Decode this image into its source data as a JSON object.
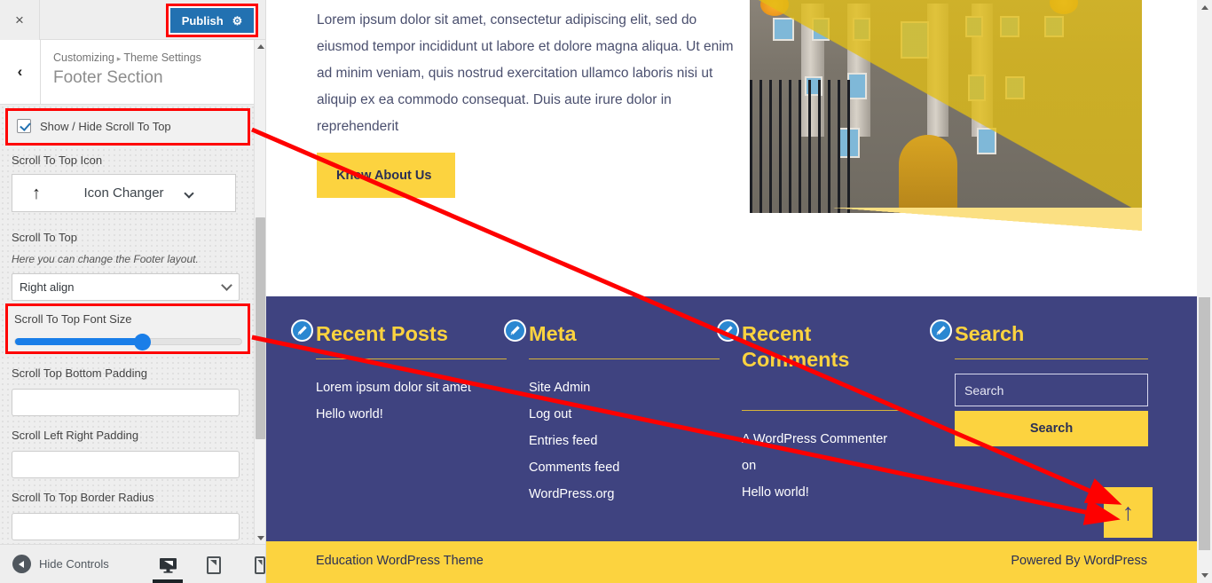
{
  "customizer": {
    "close_label": "×",
    "publish_label": "Publish",
    "gear_icon": "gear-icon",
    "back_label": "‹",
    "breadcrumb_root": "Customizing",
    "breadcrumb_sep": "▸",
    "breadcrumb_parent": "Theme Settings",
    "panel_title": "Footer Section",
    "hide_controls_label": "Hide Controls",
    "devices": [
      "desktop",
      "tablet",
      "mobile"
    ],
    "active_device": "desktop",
    "controls": {
      "show_hide_label": "Show / Hide Scroll To Top",
      "show_hide_checked": true,
      "icon_label": "Scroll To Top Icon",
      "icon_changer_text": "Icon Changer",
      "icon_glyph": "↑",
      "scroll_to_top_label": "Scroll To Top",
      "scroll_to_top_desc": "Here you can change the Footer layout.",
      "layout_value": "Right align",
      "font_size_label": "Scroll To Top Font Size",
      "font_size_percent": 56,
      "bottom_padding_label": "Scroll Top Bottom Padding",
      "bottom_padding_value": "",
      "left_right_padding_label": "Scroll Left Right Padding",
      "left_right_padding_value": "",
      "border_radius_label": "Scroll To Top Border Radius",
      "border_radius_value": ""
    },
    "highlight_color": "#fe0000",
    "accent_color": "#2271b1"
  },
  "preview": {
    "about_paragraph": "Lorem ipsum dolor sit amet, consectetur adipiscing elit, sed do eiusmod tempor incididunt ut labore et dolore magna aliqua. Ut enim ad minim veniam, quis nostrud exercitation ullamco laboris nisi ut aliquip ex ea commodo consequat. Duis aute irure dolor in reprehenderit",
    "know_button_label": "Know About Us",
    "footer": {
      "bg_color": "#3f4380",
      "accent_color": "#fcd33f",
      "widgets": [
        {
          "title": "Recent Posts",
          "edit_icon": "pencil-icon",
          "items": [
            "Lorem ipsum dolor sit amet",
            "Hello world!"
          ]
        },
        {
          "title": "Meta",
          "edit_icon": "pencil-icon",
          "items": [
            "Site Admin",
            "Log out",
            "Entries feed",
            "Comments feed",
            "WordPress.org"
          ]
        },
        {
          "title": "Recent Comments",
          "edit_icon": "pencil-icon",
          "items": [
            "A WordPress Commenter on",
            "Hello world!"
          ]
        },
        {
          "title": "Search",
          "edit_icon": "pencil-icon",
          "search_placeholder": "Search",
          "search_button_label": "Search"
        }
      ],
      "scroll_top_glyph": "↑",
      "credit_left": "Education WordPress Theme",
      "credit_right": "Powered By WordPress"
    }
  }
}
